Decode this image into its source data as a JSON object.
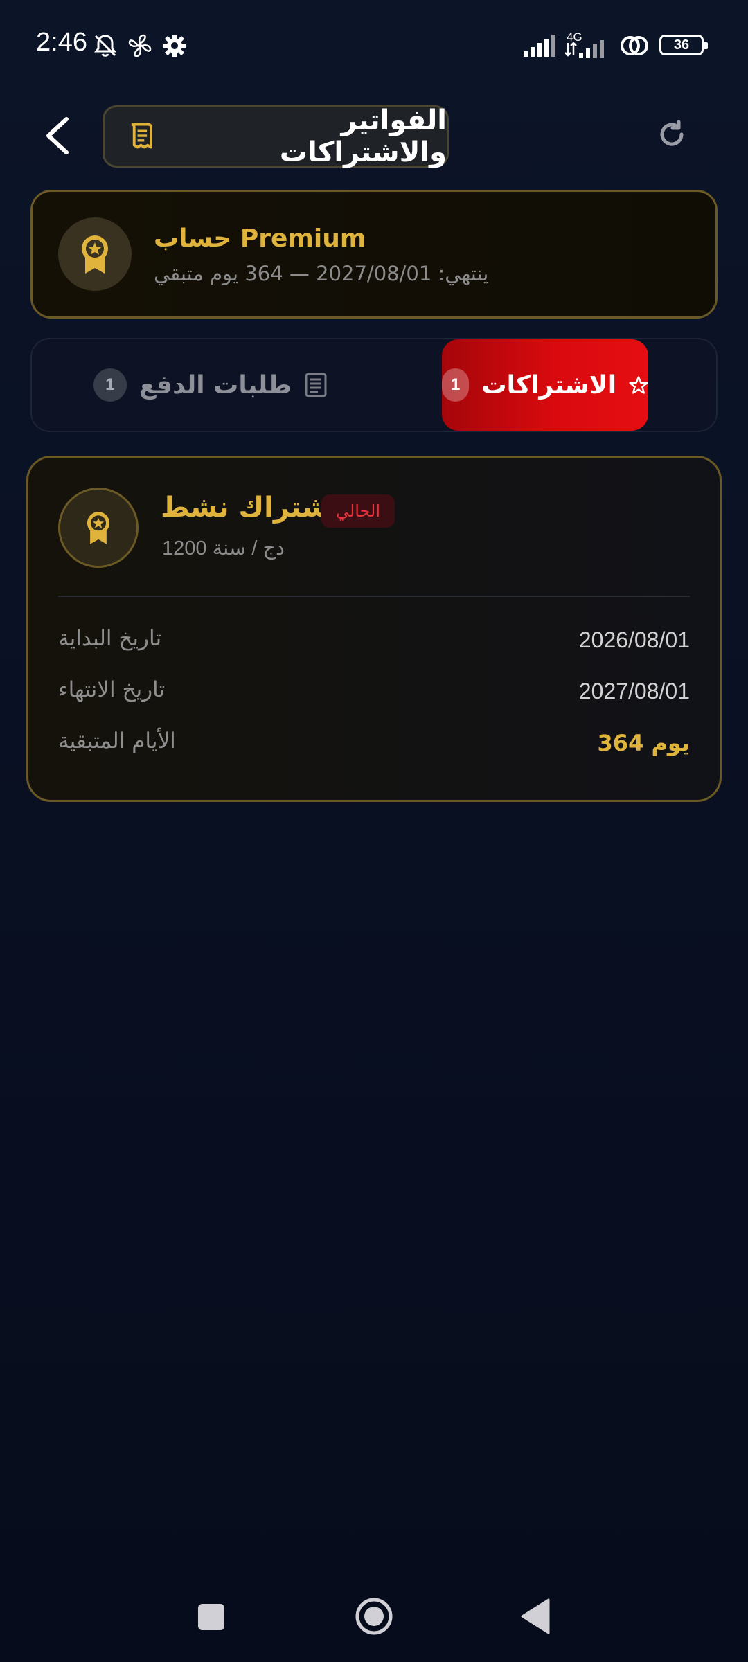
{
  "status_bar": {
    "time": "2:46",
    "network": "4G",
    "battery": "36",
    "icons": [
      "bell-off-icon",
      "fan-icon",
      "gear-icon",
      "signal-icon",
      "signal-4g-icon",
      "hotspot-icon",
      "battery-icon"
    ]
  },
  "header": {
    "title": "الفواتير والاشتراكات",
    "title_icon": "receipt-icon",
    "back_icon": "chevron-left-icon",
    "refresh_icon": "refresh-icon"
  },
  "premium": {
    "title": "حساب Premium",
    "subtitle": "ينتهي: 2027/08/01 — 364 يوم متبقي",
    "icon": "medal-icon"
  },
  "tabs": [
    {
      "label": "الاشتراكات",
      "count": "1",
      "icon": "star-icon",
      "active": true
    },
    {
      "label": "طلبات الدفع",
      "count": "1",
      "icon": "list-icon",
      "active": false
    }
  ],
  "subscription": {
    "name": "اشتراك نشط",
    "badge": "الحالي",
    "price": "دج / سنة 1200",
    "rows": [
      {
        "label": "تاريخ البداية",
        "value": "2026/08/01"
      },
      {
        "label": "تاريخ الانتهاء",
        "value": "2027/08/01"
      },
      {
        "label": "الأيام المتبقية",
        "value": "364 يوم"
      }
    ]
  },
  "colors": {
    "gold": "#e0b43c",
    "active_tab": "#d90a0e",
    "background": "#0a1124"
  }
}
